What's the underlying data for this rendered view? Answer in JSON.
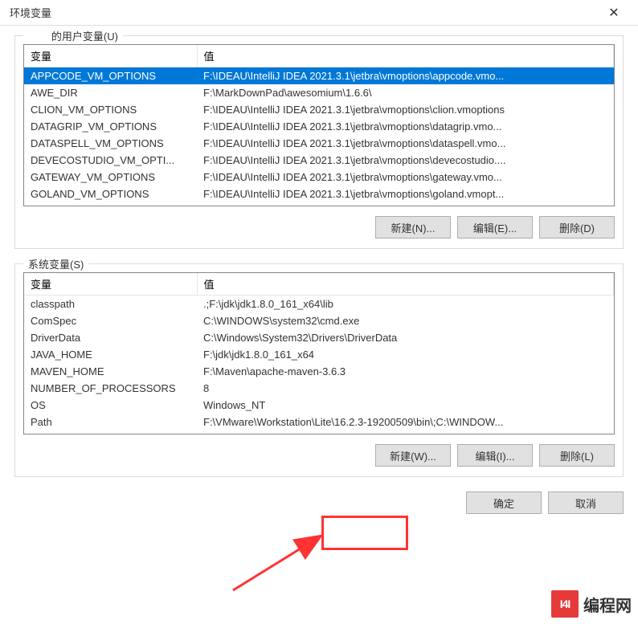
{
  "window": {
    "title": "环境变量"
  },
  "user_vars": {
    "label": "的用户变量(U)",
    "headers": {
      "var": "变量",
      "val": "值"
    },
    "rows": [
      {
        "var": "APPCODE_VM_OPTIONS",
        "val": "F:\\IDEAU\\IntelliJ IDEA 2021.3.1\\jetbra\\vmoptions\\appcode.vmo...",
        "selected": true
      },
      {
        "var": "AWE_DIR",
        "val": "F:\\MarkDownPad\\awesomium\\1.6.6\\"
      },
      {
        "var": "CLION_VM_OPTIONS",
        "val": "F:\\IDEAU\\IntelliJ IDEA 2021.3.1\\jetbra\\vmoptions\\clion.vmoptions"
      },
      {
        "var": "DATAGRIP_VM_OPTIONS",
        "val": "F:\\IDEAU\\IntelliJ IDEA 2021.3.1\\jetbra\\vmoptions\\datagrip.vmo..."
      },
      {
        "var": "DATASPELL_VM_OPTIONS",
        "val": "F:\\IDEAU\\IntelliJ IDEA 2021.3.1\\jetbra\\vmoptions\\dataspell.vmo..."
      },
      {
        "var": "DEVECOSTUDIO_VM_OPTI...",
        "val": "F:\\IDEAU\\IntelliJ IDEA 2021.3.1\\jetbra\\vmoptions\\devecostudio...."
      },
      {
        "var": "GATEWAY_VM_OPTIONS",
        "val": "F:\\IDEAU\\IntelliJ IDEA 2021.3.1\\jetbra\\vmoptions\\gateway.vmo..."
      },
      {
        "var": "GOLAND_VM_OPTIONS",
        "val": "F:\\IDEAU\\IntelliJ IDEA 2021.3.1\\jetbra\\vmoptions\\goland.vmopt..."
      }
    ],
    "buttons": {
      "new": "新建(N)...",
      "edit": "编辑(E)...",
      "delete": "删除(D)"
    }
  },
  "system_vars": {
    "label": "系统变量(S)",
    "headers": {
      "var": "变量",
      "val": "值"
    },
    "rows": [
      {
        "var": "classpath",
        "val": ".;F:\\jdk\\jdk1.8.0_161_x64\\lib"
      },
      {
        "var": "ComSpec",
        "val": "C:\\WINDOWS\\system32\\cmd.exe"
      },
      {
        "var": "DriverData",
        "val": "C:\\Windows\\System32\\Drivers\\DriverData"
      },
      {
        "var": "JAVA_HOME",
        "val": "F:\\jdk\\jdk1.8.0_161_x64"
      },
      {
        "var": "MAVEN_HOME",
        "val": "F:\\Maven\\apache-maven-3.6.3"
      },
      {
        "var": "NUMBER_OF_PROCESSORS",
        "val": "8"
      },
      {
        "var": "OS",
        "val": "Windows_NT"
      },
      {
        "var": "Path",
        "val": "F:\\VMware\\Workstation\\Lite\\16.2.3-19200509\\bin\\;C:\\WINDOW..."
      }
    ],
    "buttons": {
      "new": "新建(W)...",
      "edit": "编辑(I)...",
      "delete": "删除(L)"
    }
  },
  "bottom": {
    "ok": "确定",
    "cancel": "取消"
  },
  "logo": {
    "mark": "I4I",
    "text": "编程网"
  }
}
